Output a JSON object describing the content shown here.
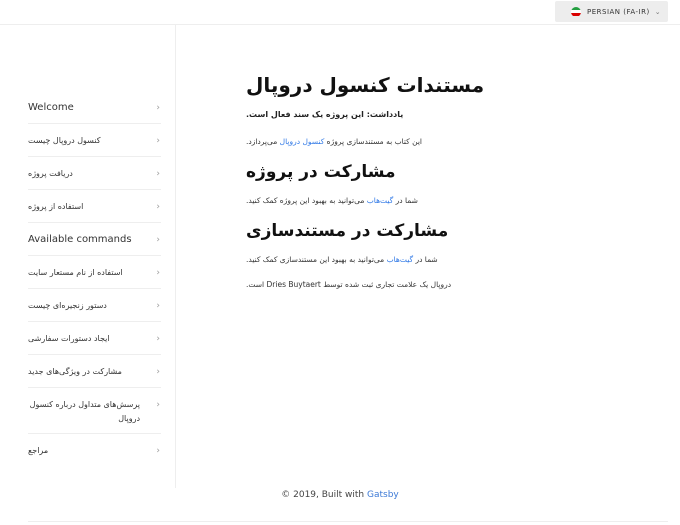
{
  "language_selector": {
    "label": "PERSIAN (FA-IR)",
    "chevron": "⌄",
    "flag_colors": [
      "#239f40",
      "#ffffff",
      "#da0000"
    ]
  },
  "sidebar": {
    "items": [
      {
        "label": "Welcome",
        "lang": "en"
      },
      {
        "label": "کنسول دروپال چیست",
        "lang": "fa"
      },
      {
        "label": "دریافت پروژه",
        "lang": "fa"
      },
      {
        "label": "استفاده از پروژه",
        "lang": "fa"
      },
      {
        "label": "Available commands",
        "lang": "en"
      },
      {
        "label": "استفاده از نام مستعار سایت",
        "lang": "fa"
      },
      {
        "label": "دستور زنجیره‌ای چیست",
        "lang": "fa"
      },
      {
        "label": "ایجاد دستورات سفارشی",
        "lang": "fa"
      },
      {
        "label": "مشارکت در ویژگی‌های جدید",
        "lang": "fa"
      },
      {
        "label": "پرسش‌های متداول درباره کنسول دروپال",
        "lang": "fa"
      },
      {
        "label": "مراجع",
        "lang": "fa"
      }
    ],
    "chevron": "›"
  },
  "content": {
    "title": "مستندات کنسول دروپال",
    "note": "یادداشت: این پروژه یک سند فعال است.",
    "intro_prefix": "این کتاب به مستندسازی پروژه ",
    "intro_link": "کنسول دروپال",
    "intro_suffix": " می‌پردازد.",
    "h2_project": "مشارکت در پروژه",
    "project_prefix": "شما در ",
    "project_link": "گیت‌هاب",
    "project_suffix": " می‌توانید به بهبود این پروژه کمک کنید.",
    "h2_docs": "مشارکت در مستندسازی",
    "docs_prefix": "شما در ",
    "docs_link": "گیت‌هاب",
    "docs_suffix": " می‌توانید به بهبود این مستندسازی کمک کنید.",
    "trademark": "دروپال یک علامت تجاری ثبت شده توسط Dries Buytaert است."
  },
  "footer": {
    "prefix": "© 2019, Built with ",
    "link": "Gatsby"
  }
}
